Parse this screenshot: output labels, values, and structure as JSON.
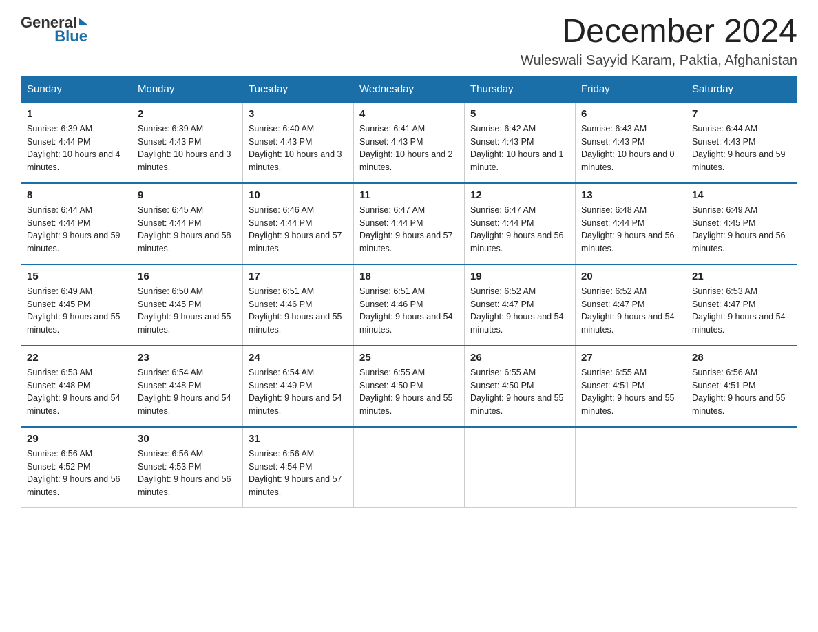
{
  "logo": {
    "general": "General",
    "blue": "Blue"
  },
  "header": {
    "month": "December 2024",
    "location": "Wuleswali Sayyid Karam, Paktia, Afghanistan"
  },
  "columns": [
    "Sunday",
    "Monday",
    "Tuesday",
    "Wednesday",
    "Thursday",
    "Friday",
    "Saturday"
  ],
  "weeks": [
    [
      {
        "day": "1",
        "sunrise": "6:39 AM",
        "sunset": "4:44 PM",
        "daylight": "10 hours and 4 minutes."
      },
      {
        "day": "2",
        "sunrise": "6:39 AM",
        "sunset": "4:43 PM",
        "daylight": "10 hours and 3 minutes."
      },
      {
        "day": "3",
        "sunrise": "6:40 AM",
        "sunset": "4:43 PM",
        "daylight": "10 hours and 3 minutes."
      },
      {
        "day": "4",
        "sunrise": "6:41 AM",
        "sunset": "4:43 PM",
        "daylight": "10 hours and 2 minutes."
      },
      {
        "day": "5",
        "sunrise": "6:42 AM",
        "sunset": "4:43 PM",
        "daylight": "10 hours and 1 minute."
      },
      {
        "day": "6",
        "sunrise": "6:43 AM",
        "sunset": "4:43 PM",
        "daylight": "10 hours and 0 minutes."
      },
      {
        "day": "7",
        "sunrise": "6:44 AM",
        "sunset": "4:43 PM",
        "daylight": "9 hours and 59 minutes."
      }
    ],
    [
      {
        "day": "8",
        "sunrise": "6:44 AM",
        "sunset": "4:44 PM",
        "daylight": "9 hours and 59 minutes."
      },
      {
        "day": "9",
        "sunrise": "6:45 AM",
        "sunset": "4:44 PM",
        "daylight": "9 hours and 58 minutes."
      },
      {
        "day": "10",
        "sunrise": "6:46 AM",
        "sunset": "4:44 PM",
        "daylight": "9 hours and 57 minutes."
      },
      {
        "day": "11",
        "sunrise": "6:47 AM",
        "sunset": "4:44 PM",
        "daylight": "9 hours and 57 minutes."
      },
      {
        "day": "12",
        "sunrise": "6:47 AM",
        "sunset": "4:44 PM",
        "daylight": "9 hours and 56 minutes."
      },
      {
        "day": "13",
        "sunrise": "6:48 AM",
        "sunset": "4:44 PM",
        "daylight": "9 hours and 56 minutes."
      },
      {
        "day": "14",
        "sunrise": "6:49 AM",
        "sunset": "4:45 PM",
        "daylight": "9 hours and 56 minutes."
      }
    ],
    [
      {
        "day": "15",
        "sunrise": "6:49 AM",
        "sunset": "4:45 PM",
        "daylight": "9 hours and 55 minutes."
      },
      {
        "day": "16",
        "sunrise": "6:50 AM",
        "sunset": "4:45 PM",
        "daylight": "9 hours and 55 minutes."
      },
      {
        "day": "17",
        "sunrise": "6:51 AM",
        "sunset": "4:46 PM",
        "daylight": "9 hours and 55 minutes."
      },
      {
        "day": "18",
        "sunrise": "6:51 AM",
        "sunset": "4:46 PM",
        "daylight": "9 hours and 54 minutes."
      },
      {
        "day": "19",
        "sunrise": "6:52 AM",
        "sunset": "4:47 PM",
        "daylight": "9 hours and 54 minutes."
      },
      {
        "day": "20",
        "sunrise": "6:52 AM",
        "sunset": "4:47 PM",
        "daylight": "9 hours and 54 minutes."
      },
      {
        "day": "21",
        "sunrise": "6:53 AM",
        "sunset": "4:47 PM",
        "daylight": "9 hours and 54 minutes."
      }
    ],
    [
      {
        "day": "22",
        "sunrise": "6:53 AM",
        "sunset": "4:48 PM",
        "daylight": "9 hours and 54 minutes."
      },
      {
        "day": "23",
        "sunrise": "6:54 AM",
        "sunset": "4:48 PM",
        "daylight": "9 hours and 54 minutes."
      },
      {
        "day": "24",
        "sunrise": "6:54 AM",
        "sunset": "4:49 PM",
        "daylight": "9 hours and 54 minutes."
      },
      {
        "day": "25",
        "sunrise": "6:55 AM",
        "sunset": "4:50 PM",
        "daylight": "9 hours and 55 minutes."
      },
      {
        "day": "26",
        "sunrise": "6:55 AM",
        "sunset": "4:50 PM",
        "daylight": "9 hours and 55 minutes."
      },
      {
        "day": "27",
        "sunrise": "6:55 AM",
        "sunset": "4:51 PM",
        "daylight": "9 hours and 55 minutes."
      },
      {
        "day": "28",
        "sunrise": "6:56 AM",
        "sunset": "4:51 PM",
        "daylight": "9 hours and 55 minutes."
      }
    ],
    [
      {
        "day": "29",
        "sunrise": "6:56 AM",
        "sunset": "4:52 PM",
        "daylight": "9 hours and 56 minutes."
      },
      {
        "day": "30",
        "sunrise": "6:56 AM",
        "sunset": "4:53 PM",
        "daylight": "9 hours and 56 minutes."
      },
      {
        "day": "31",
        "sunrise": "6:56 AM",
        "sunset": "4:54 PM",
        "daylight": "9 hours and 57 minutes."
      },
      null,
      null,
      null,
      null
    ]
  ]
}
